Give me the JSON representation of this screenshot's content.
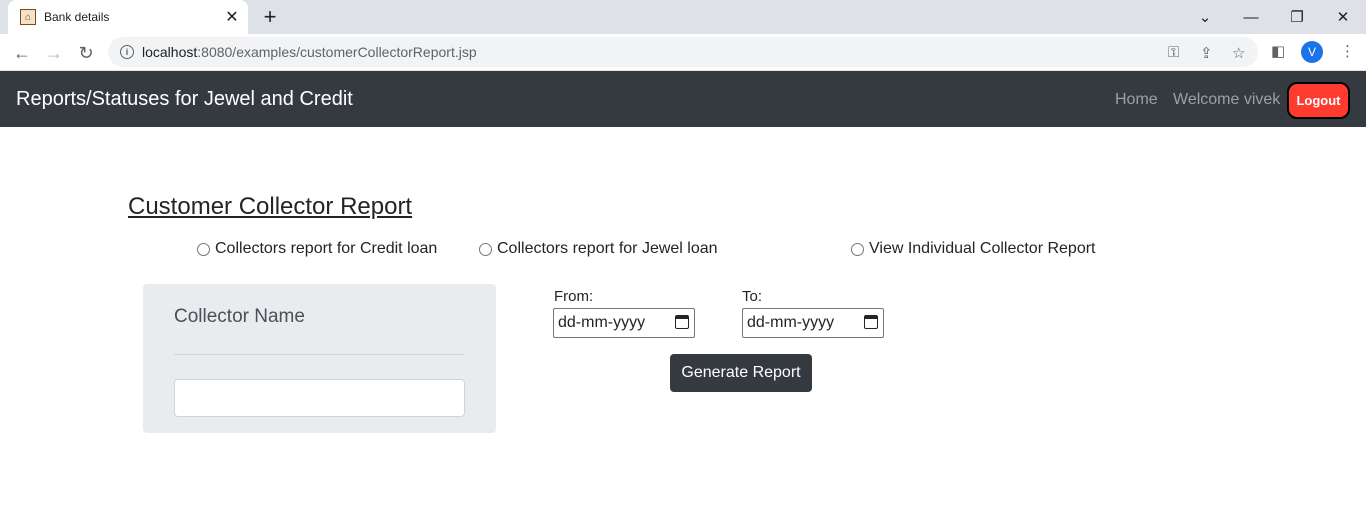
{
  "browser": {
    "tab_title": "Bank details",
    "url_host": "localhost",
    "url_rest": ":8080/examples/customerCollectorReport.jsp",
    "avatar_letter": "V"
  },
  "navbar": {
    "brand": "Reports/Statuses for Jewel and Credit",
    "home": "Home",
    "welcome": "Welcome vivek",
    "logout": "Logout"
  },
  "report": {
    "title": "Customer Collector Report",
    "options": [
      "Collectors report for Credit loan",
      "Collectors report for Jewel loan",
      "View Individual Collector Report"
    ],
    "collector_label": "Collector Name",
    "collector_value": "",
    "from_label": "From:",
    "to_label": "To:",
    "date_placeholder": "dd-mm-yyyy",
    "generate": "Generate Report"
  },
  "colors": {
    "navbar_bg": "#343a40",
    "logout_bg": "#ff3b30",
    "panel_bg": "#e9ecef"
  }
}
